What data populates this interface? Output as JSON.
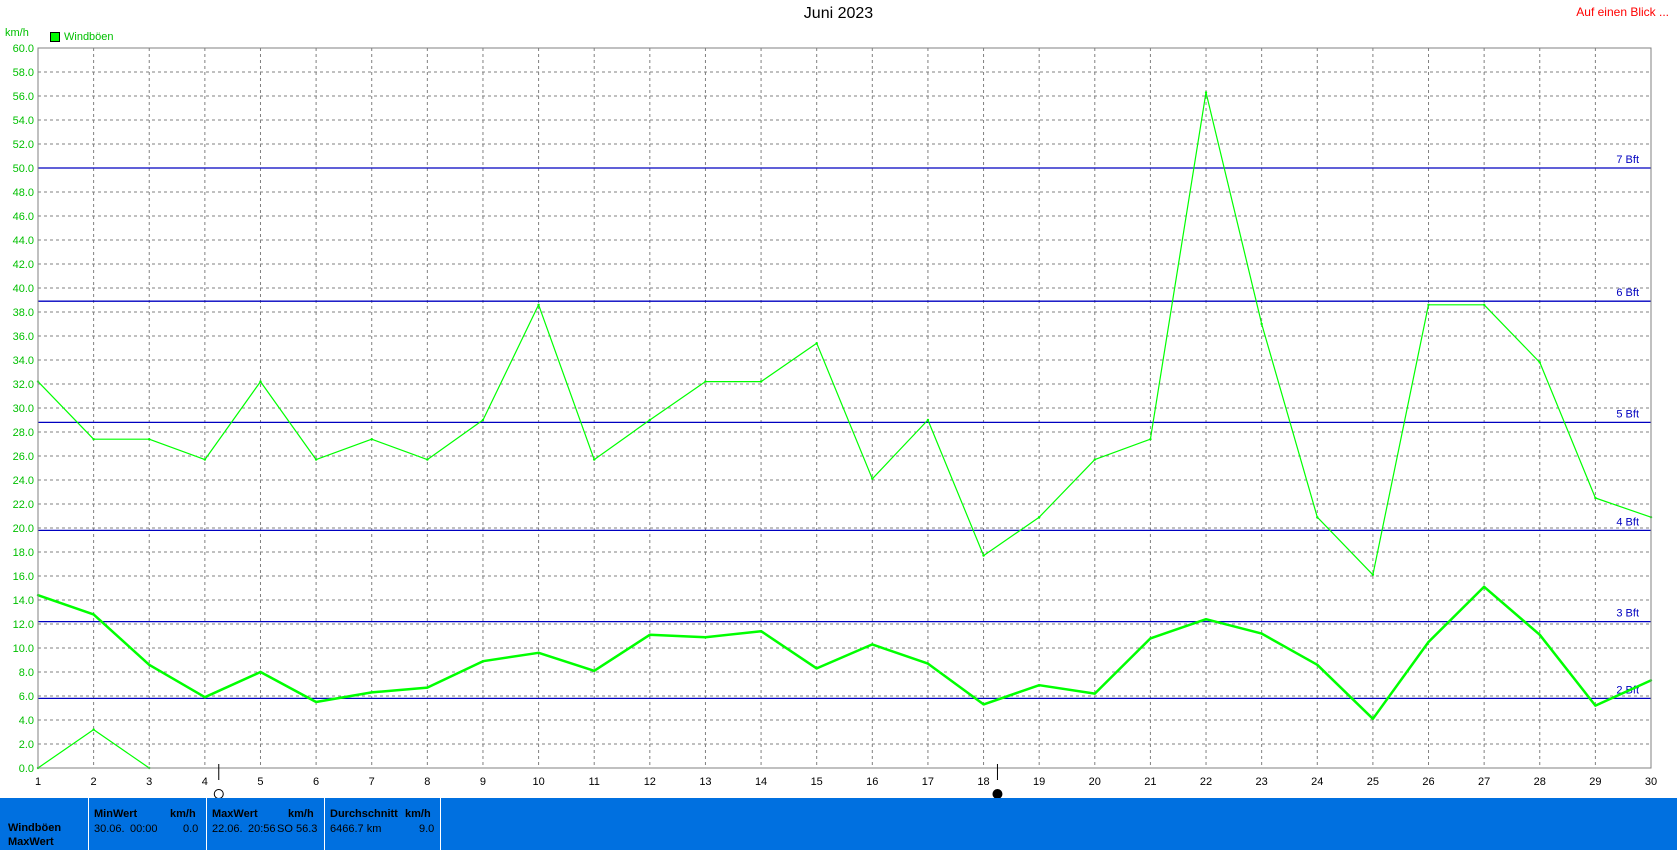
{
  "title": "Juni 2023",
  "glance_link": "Auf einen Blick ...",
  "unit": "km/h",
  "legend": {
    "label": "Windböen",
    "color": "#00ff00"
  },
  "colors": {
    "series": "#00ff00",
    "beaufort_lines": "#0000c0",
    "grid": "#808080",
    "axis_labels": "#00c000",
    "footer": "#0070e0"
  },
  "chart_data": {
    "type": "line",
    "title": "Juni 2023",
    "ylabel": "km/h",
    "xlabel": "",
    "ylim": [
      0,
      60
    ],
    "xlim": [
      1,
      30
    ],
    "grid": true,
    "legend_position": "top-left",
    "x_ticks": [
      "1",
      "2",
      "3",
      "4",
      "5",
      "6",
      "7",
      "8",
      "9",
      "10",
      "11",
      "12",
      "13",
      "14",
      "15",
      "16",
      "17",
      "18",
      "19",
      "20",
      "21",
      "22",
      "23",
      "24",
      "25",
      "26",
      "27",
      "28",
      "29",
      "30"
    ],
    "y_ticks": [
      "0.0",
      "2.0",
      "4.0",
      "6.0",
      "8.0",
      "10.0",
      "12.0",
      "14.0",
      "16.0",
      "18.0",
      "20.0",
      "22.0",
      "24.0",
      "26.0",
      "28.0",
      "30.0",
      "32.0",
      "34.0",
      "36.0",
      "38.0",
      "40.0",
      "42.0",
      "44.0",
      "46.0",
      "48.0",
      "50.0",
      "52.0",
      "54.0",
      "56.0",
      "58.0",
      "60.0"
    ],
    "series": [
      {
        "name": "Windböen",
        "role": "max",
        "x": [
          1,
          2,
          3,
          4,
          5,
          6,
          7,
          8,
          9,
          10,
          11,
          12,
          13,
          14,
          15,
          16,
          17,
          18,
          19,
          20,
          21,
          22,
          23,
          24,
          25,
          26,
          27,
          28,
          29,
          30
        ],
        "values": [
          32.2,
          27.4,
          27.4,
          25.7,
          32.2,
          25.7,
          27.4,
          25.7,
          29.0,
          38.6,
          25.7,
          29.0,
          32.2,
          32.2,
          35.4,
          24.1,
          29.0,
          17.7,
          20.9,
          25.7,
          27.4,
          56.3,
          37.0,
          20.9,
          16.1,
          38.6,
          38.6,
          33.8,
          22.5,
          20.9
        ]
      },
      {
        "name": "Windböen",
        "role": "avg",
        "x": [
          1,
          2,
          3,
          4,
          5,
          6,
          7,
          8,
          9,
          10,
          11,
          12,
          13,
          14,
          15,
          16,
          17,
          18,
          19,
          20,
          21,
          22,
          23,
          24,
          25,
          26,
          27,
          28,
          29,
          30
        ],
        "values": [
          14.4,
          12.8,
          8.6,
          5.9,
          8.0,
          5.5,
          6.3,
          6.7,
          8.9,
          9.6,
          8.1,
          11.1,
          10.9,
          11.4,
          8.3,
          10.3,
          8.7,
          5.3,
          6.9,
          6.2,
          10.8,
          12.4,
          11.2,
          8.6,
          4.1,
          10.5,
          15.1,
          11.1,
          5.2,
          7.3
        ]
      },
      {
        "name": "Windböen",
        "role": "min",
        "x": [
          1,
          2,
          3
        ],
        "values": [
          0.0,
          3.2,
          0.0
        ]
      }
    ],
    "reference_lines": [
      {
        "label": "2 Bft",
        "value": 5.8
      },
      {
        "label": "3 Bft",
        "value": 12.2
      },
      {
        "label": "4 Bft",
        "value": 19.8
      },
      {
        "label": "5 Bft",
        "value": 28.8
      },
      {
        "label": "6 Bft",
        "value": 38.9
      },
      {
        "label": "7 Bft",
        "value": 50.0
      }
    ],
    "moon_markers": [
      {
        "x": 4.25,
        "phase": "new"
      },
      {
        "x": 18.25,
        "phase": "full"
      }
    ]
  },
  "stats": {
    "row_labels": [
      "Windböen",
      "MaxWert"
    ],
    "min": {
      "header": "MinWert",
      "unit": "km/h",
      "date": "30.06.",
      "time": "00:00",
      "value": "0.0"
    },
    "max": {
      "header": "MaxWert",
      "unit": "km/h",
      "date": "22.06.",
      "time": "20:56",
      "dir": "SO",
      "value": "56.3"
    },
    "avg": {
      "header": "Durchschnitt",
      "unit": "km/h",
      "distance": "6466.7 km",
      "value": "9.0"
    }
  }
}
